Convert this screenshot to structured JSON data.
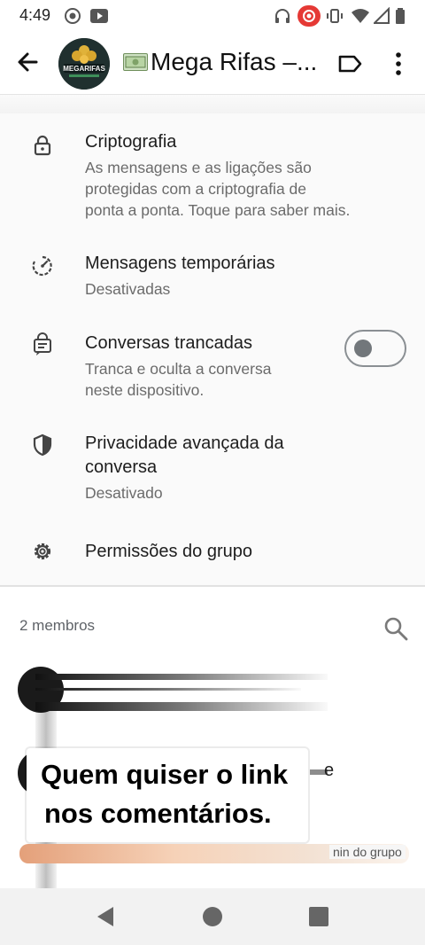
{
  "status_bar": {
    "time": "4:49",
    "icons": [
      "record-icon",
      "screen-cast-icon",
      "headphones-icon",
      "recording-dot-icon",
      "vibrate-icon",
      "wifi-icon",
      "signal-icon",
      "battery-icon"
    ]
  },
  "header": {
    "title": "Mega Rifas –...",
    "avatar_text": "MEGARIFAS",
    "title_emoji": "money-bill-icon",
    "icons": [
      "back-arrow-icon",
      "label-icon",
      "more-vert-icon"
    ]
  },
  "settings": [
    {
      "title": "Criptografia",
      "subtitle_lines": [
        "As mensagens e as ligações são",
        "protegidas com a criptografia de",
        "ponta a ponta. Toque para saber mais."
      ],
      "icon": "lock-icon"
    },
    {
      "title": "Mensagens temporárias",
      "subtitle_lines": [
        "Desativadas"
      ],
      "icon": "timer-icon"
    },
    {
      "title": "Conversas trancadas",
      "subtitle_lines": [
        "Tranca e oculta a conversa",
        "neste dispositivo."
      ],
      "icon": "locked-chat-icon",
      "toggle_on": false
    },
    {
      "title_lines": [
        "Privacidade avançada da",
        "conversa"
      ],
      "subtitle_lines": [
        "Desativado"
      ],
      "icon": "shield-icon"
    },
    {
      "title": "Permissões do grupo",
      "icon": "gear-icon"
    }
  ],
  "members": {
    "count_label": "2 membros",
    "partial_name_suffix": "e",
    "role_label": "nin do grupo",
    "search_icon": "search-icon"
  },
  "caption": {
    "line1": "Quem quiser o link",
    "line2": "nos comentários."
  },
  "nav_bar": {
    "icons": [
      "nav-back-icon",
      "nav-home-icon",
      "nav-recents-icon"
    ]
  },
  "colors": {
    "toggle_off": "#72777b",
    "settings_bg": "#fafafa",
    "secondary_text": "#6b6b6b"
  }
}
